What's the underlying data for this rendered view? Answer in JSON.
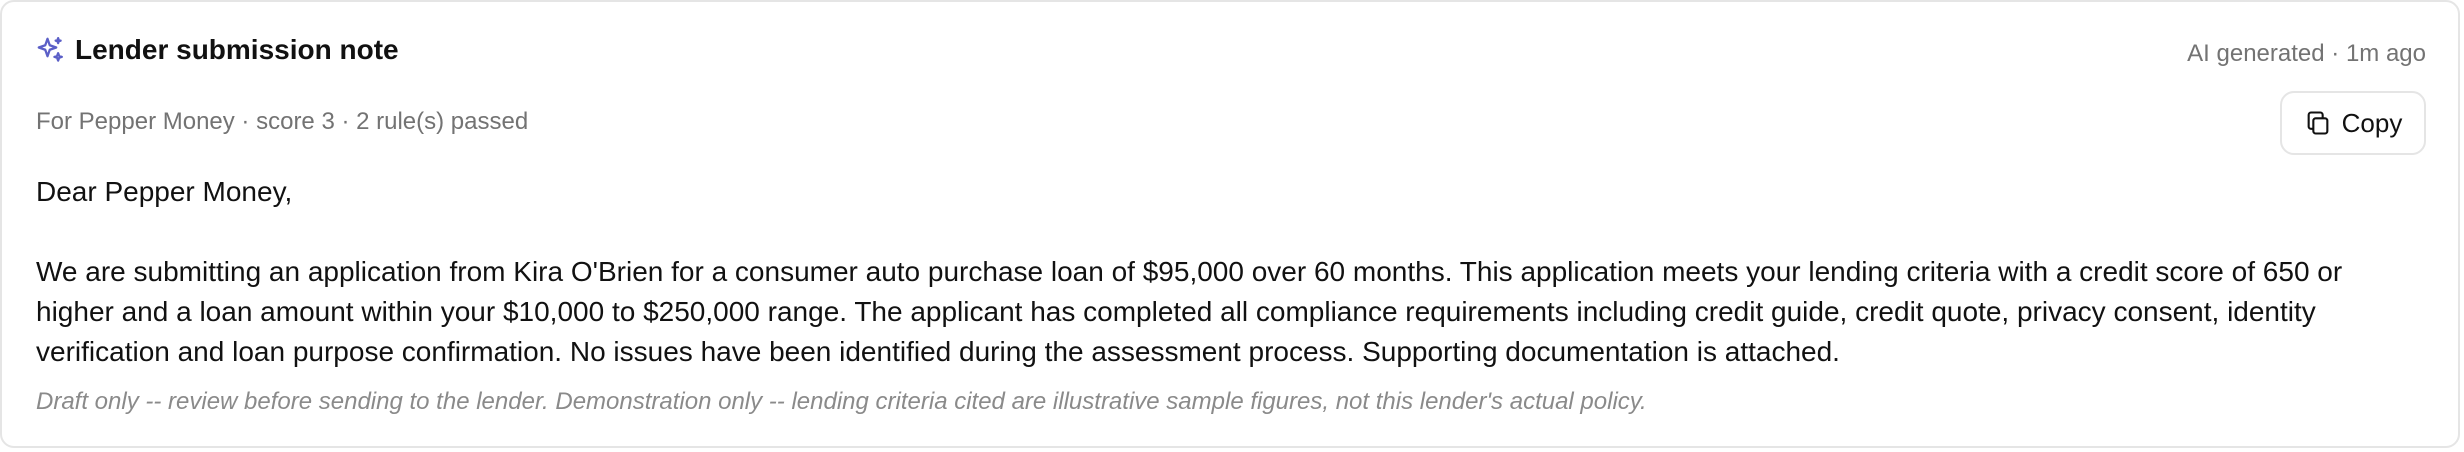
{
  "card": {
    "title": "Lender submission note",
    "meta": "AI generated · 1m ago",
    "subtitle": "For Pepper Money · score 3 · 2 rule(s) passed",
    "copy_label": "Copy",
    "greeting": "Dear Pepper Money,",
    "paragraph": "We are submitting an application from Kira O'Brien for a consumer auto purchase loan of $95,000 over 60 months. This application meets your lending criteria with a credit score of 650 or higher and a loan amount within your $10,000 to $250,000 range. The applicant has completed all compliance requirements including credit guide, credit quote, privacy consent, identity verification and loan purpose confirmation. No issues have been identified during the assessment process. Supporting documentation is attached.",
    "disclaimer": "Draft only -- review before sending to the lender. Demonstration only -- lending criteria cited are illustrative sample figures, not this lender's actual policy."
  },
  "icons": {
    "title_icon": "sparkle-icon",
    "copy_icon": "copy-icon"
  },
  "colors": {
    "accent": "#5b5fc7",
    "muted_text": "#737373",
    "border": "#e5e5e5"
  }
}
